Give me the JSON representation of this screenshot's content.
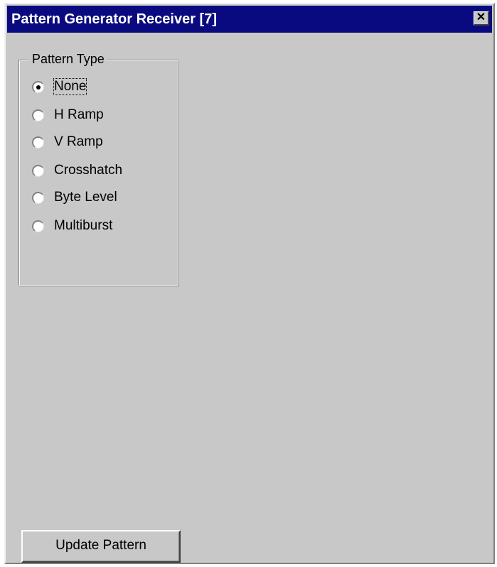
{
  "window": {
    "title": "Pattern Generator Receiver [7]",
    "close_glyph": "✕"
  },
  "pattern_type": {
    "legend": "Pattern Type",
    "options": [
      {
        "label": "None",
        "selected": true
      },
      {
        "label": "H Ramp",
        "selected": false
      },
      {
        "label": "V Ramp",
        "selected": false
      },
      {
        "label": "Crosshatch",
        "selected": false
      },
      {
        "label": "Byte Level",
        "selected": false
      },
      {
        "label": "Multiburst",
        "selected": false
      }
    ]
  },
  "actions": {
    "update_label": "Update Pattern"
  },
  "colors": {
    "titlebar": "#0a0a80",
    "face": "#c8c8c8"
  }
}
